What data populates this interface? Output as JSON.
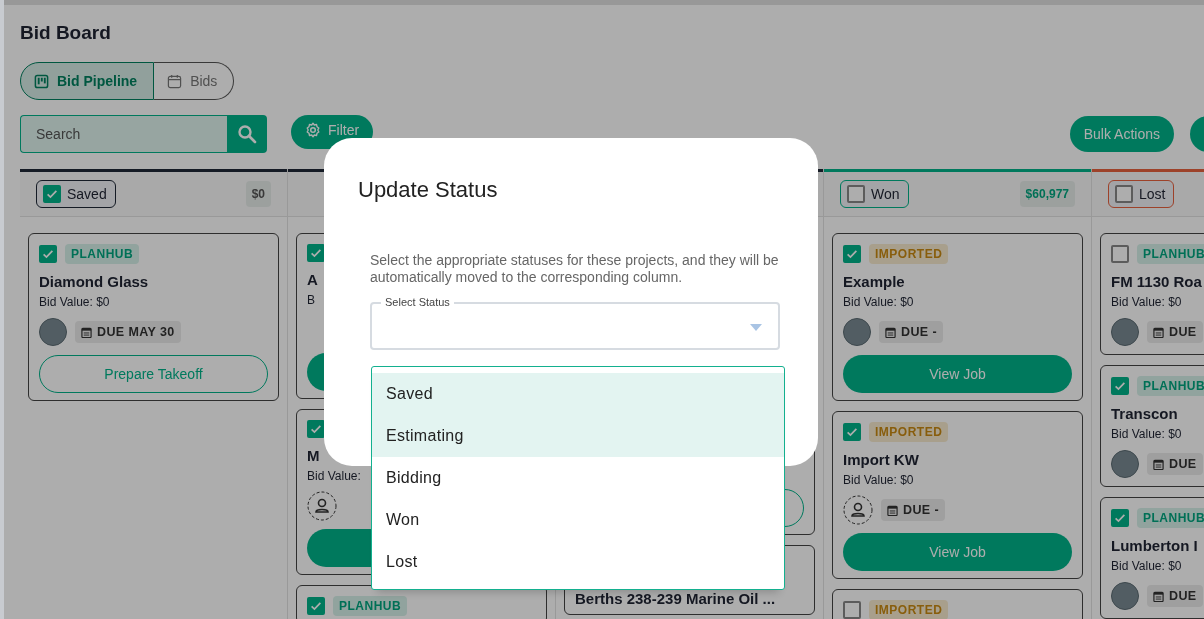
{
  "page": {
    "title": "Bid Board"
  },
  "view_tabs": [
    {
      "label": "Bid Pipeline",
      "selected": true
    },
    {
      "label": "Bids",
      "selected": false
    }
  ],
  "toolbar": {
    "search": {
      "placeholder": "Search"
    },
    "filter": "Filter",
    "bulk_actions": "Bulk Actions"
  },
  "columns": [
    {
      "kind": "open",
      "header": {
        "label": "Saved",
        "checked": true,
        "total": "$0"
      },
      "cards": [
        {
          "checked": true,
          "tag": {
            "label": "PLANHUB",
            "kind": "planhub"
          },
          "title": "Diamond Glass",
          "bid_value": "Bid Value: $0",
          "avatar": {
            "kind": "photo"
          },
          "due": "DUE MAY 30",
          "action": {
            "kind": "outline",
            "label": "Prepare Takeoff"
          }
        }
      ]
    },
    {
      "kind": "open",
      "cards": [
        {
          "checked": true,
          "title": "A",
          "bid_value": "B",
          "action": {
            "kind": "filled"
          }
        },
        {
          "checked": true,
          "title": "M",
          "bid_value": "Bid Value:",
          "avatar": {
            "kind": "empty"
          },
          "action": {
            "kind": "filled"
          }
        },
        {
          "checked": true,
          "tag": {
            "label": "PLANHUB",
            "kind": "planhub"
          }
        }
      ]
    },
    {
      "kind": "open",
      "cards": [
        {
          "action": {
            "kind": "outline"
          }
        },
        {
          "title": "Berths 238-239 Marine Oil ..."
        }
      ]
    },
    {
      "kind": "won",
      "header": {
        "label": "Won",
        "checked": false,
        "total": "$60,977"
      },
      "cards": [
        {
          "checked": true,
          "tag": {
            "label": "IMPORTED",
            "kind": "imported"
          },
          "title": "Example",
          "bid_value": "Bid Value: $0",
          "avatar": {
            "kind": "photo"
          },
          "due": "DUE -",
          "action": {
            "kind": "filled",
            "label": "View Job"
          }
        },
        {
          "checked": true,
          "tag": {
            "label": "IMPORTED",
            "kind": "imported"
          },
          "title": "Import KW",
          "bid_value": "Bid Value: $0",
          "avatar": {
            "kind": "empty"
          },
          "due": "DUE -",
          "action": {
            "kind": "filled",
            "label": "View Job"
          }
        },
        {
          "checked": false,
          "tag": {
            "label": "IMPORTED",
            "kind": "imported"
          }
        }
      ]
    },
    {
      "kind": "lost",
      "header": {
        "label": "Lost",
        "checked": false
      },
      "cards": [
        {
          "checked": false,
          "tag": {
            "label": "PLANHUB",
            "kind": "planhub"
          },
          "title": "FM 1130 Roa",
          "bid_value": "Bid Value: $0",
          "avatar": {
            "kind": "photo"
          },
          "due": "DUE"
        },
        {
          "checked": true,
          "tag": {
            "label": "PLANHUB",
            "kind": "planhub"
          },
          "title": "Transcon",
          "bid_value": "Bid Value: $0",
          "avatar": {
            "kind": "photo"
          },
          "due": "DUE"
        },
        {
          "checked": true,
          "tag": {
            "label": "PLANHUB",
            "kind": "planhub"
          },
          "title": "Lumberton I",
          "bid_value": "Bid Value: $0",
          "avatar": {
            "kind": "photo"
          },
          "due": "DUE"
        }
      ]
    }
  ],
  "modal": {
    "title": "Update Status",
    "description": "Select the appropriate statuses for these projects, and they will be automatically moved to the corresponding column.",
    "select_label": "Select Status",
    "options": [
      {
        "label": "Saved",
        "selected": true
      },
      {
        "label": "Estimating",
        "selected": true
      },
      {
        "label": "Bidding",
        "selected": false
      },
      {
        "label": "Won",
        "selected": false
      },
      {
        "label": "Lost",
        "selected": false
      }
    ]
  }
}
